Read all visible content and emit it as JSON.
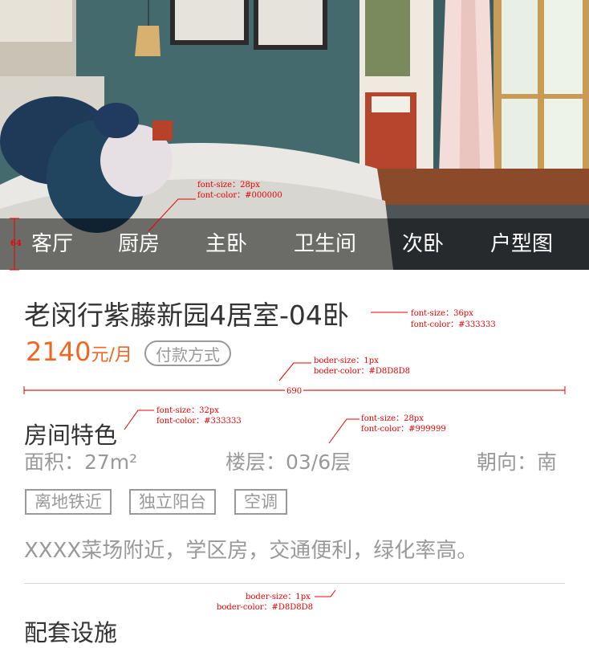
{
  "tabs": [
    "客厅",
    "厨房",
    "主卧",
    "卫生间",
    "次卧",
    "户型图"
  ],
  "listing": {
    "title": "老闵行紫藤新园4居室-04卧",
    "price": "2140",
    "price_unit": "元/月",
    "payment_button": "付款方式"
  },
  "features": {
    "heading": "房间特色",
    "area": "面积：27m²",
    "floor": "楼层：03/6层",
    "orientation": "朝向：南",
    "tags": [
      "离地铁近",
      "独立阳台",
      "空调"
    ],
    "description": "XXXX菜场附近，学区房，交通便利，绿化率高。"
  },
  "section2": {
    "heading": "配套设施"
  },
  "annotations": {
    "tab_font_size": "font-size：28px",
    "tab_font_color": "font-color：#000000",
    "tab_height": "64",
    "title_font_size": "font-size：36px",
    "title_font_color": "font-color：#333333",
    "divider_size": "boder-size：1px",
    "divider_color": "boder-color：#D8D8D8",
    "divider_width": "690",
    "heading_font_size": "font-size：32px",
    "heading_font_color": "font-color：#333333",
    "meta_font_size": "font-size：28px",
    "meta_font_color": "font-color：#999999",
    "divider2_size": "boder-size：1px",
    "divider2_color": "boder-color：#D8D8D8"
  },
  "colors": {
    "accent": "#f26522",
    "text": "#333333",
    "muted": "#999999",
    "divider": "#D8D8D8",
    "annotation": "#ee0000"
  }
}
